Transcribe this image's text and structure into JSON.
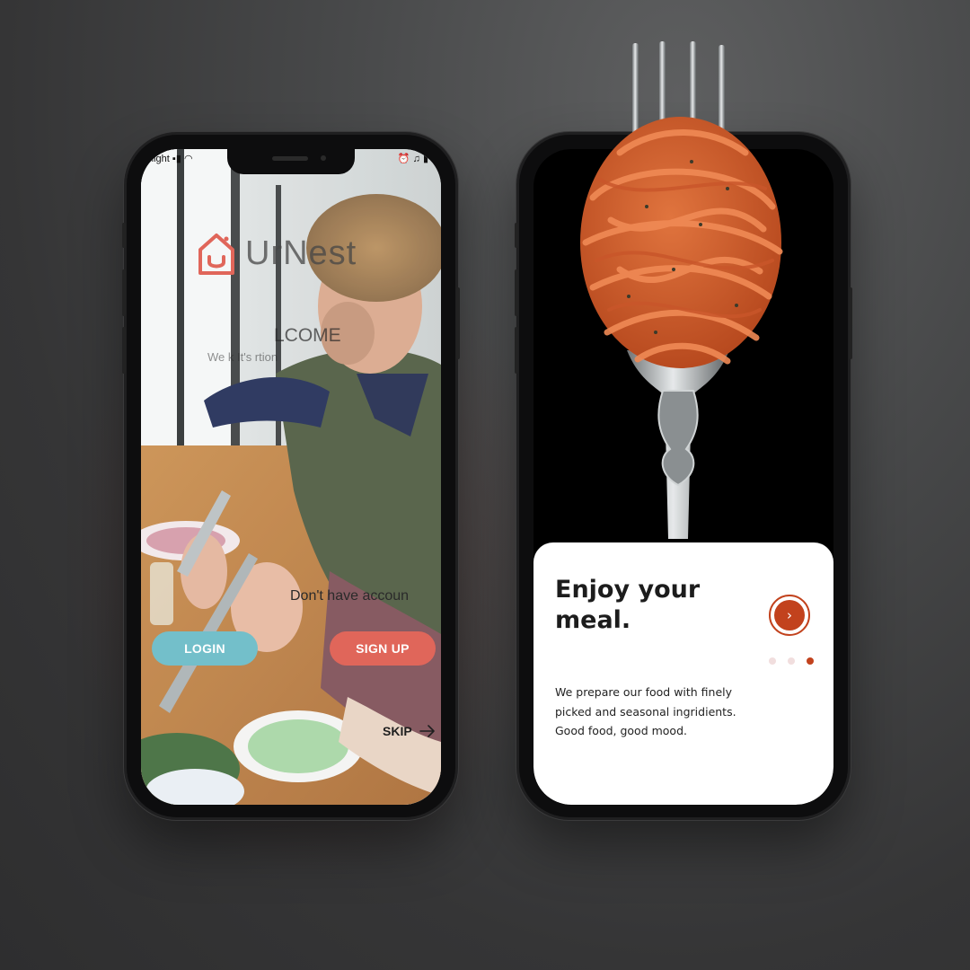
{
  "left_phone": {
    "status_bar": {
      "carrier": "night",
      "icons": [
        "signal-icon",
        "wifi-icon",
        "alarm-icon",
        "headphones-icon",
        "battery-icon"
      ]
    },
    "brand": {
      "name": "UrNest",
      "logo_icon": "house-smile-icon",
      "logo_color": "#e0665a"
    },
    "welcome_text": "LCOME",
    "tagline_text": "We k        It's     rtion",
    "no_account_text": "Don't have accoun",
    "login_label": "LOGIN",
    "signup_label": "SIGN UP",
    "skip_label": "SKIP",
    "colors": {
      "login": "#73bfca",
      "signup": "#e0665a"
    }
  },
  "right_phone": {
    "title": "Enjoy your meal.",
    "description": "We prepare our food with finely picked and seasonal ingridients. Good food, good mood.",
    "next_icon": "chevron-right-icon",
    "pagination": {
      "total": 3,
      "active": 3
    },
    "accent_color": "#c2421d"
  }
}
